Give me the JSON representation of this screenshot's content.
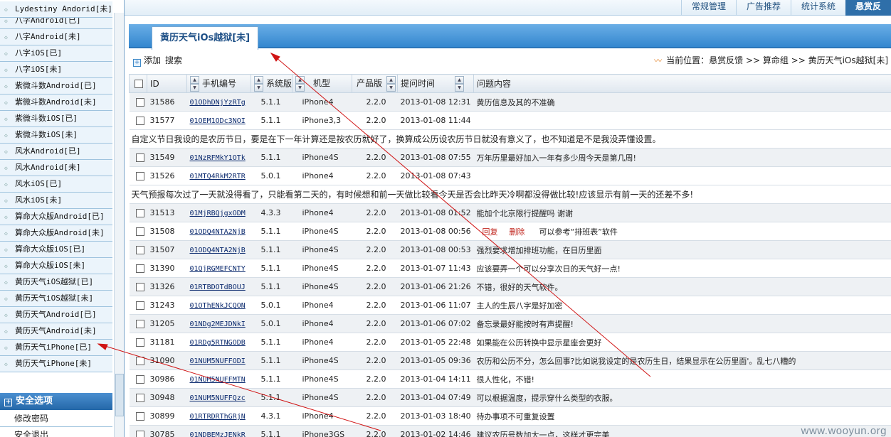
{
  "top_nav": [
    "常规管理",
    "广告推荐",
    "统计系统",
    "悬赏反"
  ],
  "sidebar": {
    "items": [
      "Lydestiny Andorid[未]",
      "八字Android[已]",
      "八字Android[未]",
      "八字iOS[已]",
      "八字iOS[未]",
      "紫微斗数Android[已]",
      "紫微斗数Android[未]",
      "紫微斗数iOS[已]",
      "紫微斗数iOS[未]",
      "风水Android[已]",
      "风水Android[未]",
      "风水iOS[已]",
      "风水iOS[未]",
      "算命大众版Android[已]",
      "算命大众版Android[未]",
      "算命大众版iOS[已]",
      "算命大众版iOS[未]",
      "黄历天气iOS越狱[已]",
      "黄历天气iOS越狱[未]",
      "黄历天气Android[已]",
      "黄历天气Android[未]",
      "黄历天气iPhone[已]",
      "黄历天气iPhone[未]"
    ],
    "section_title": "安全选项",
    "section_items": [
      "修改密码",
      "安全退出"
    ]
  },
  "tab_title": "黄历天气iOs越狱[未]",
  "toolbar": {
    "add": "添加",
    "search": "搜索"
  },
  "location": "当前位置：悬赏反馈 >> 算命组 >> 黄历天气iOs越狱[未]",
  "columns": [
    "ID",
    "手机编号",
    "系统版",
    "机型",
    "产品版",
    "提问时间",
    "问题内容"
  ],
  "actions": {
    "reply": "回复",
    "delete": "删除"
  },
  "rows": [
    {
      "id": "31586",
      "phone": "01ODhDNjYzRTg",
      "os": "5.1.1",
      "model": "iPhone4",
      "ver": "2.2.0",
      "time": "2013-01-08 12:31",
      "content": "黄历信息及其的不准确"
    },
    {
      "id": "31577",
      "phone": "01OEM1ODc3NOI",
      "os": "5.1.1",
      "model": "iPhone3,3",
      "ver": "2.2.0",
      "time": "2013-01-08 11:44",
      "content": "",
      "note": "自定义节日我设的是农历节日，要是在下一年计算还是按农历就好了，换算成公历设农历节日就没有意义了，也不知道是不是我没弄懂设置。"
    },
    {
      "id": "31549",
      "phone": "01NzRFMkY1OTk",
      "os": "5.1.1",
      "model": "iPhone4S",
      "ver": "2.2.0",
      "time": "2013-01-08 07:55",
      "content": "万年历里最好加入一年有多少周今天是第几周!"
    },
    {
      "id": "31526",
      "phone": "01MTQ4RkM2RTR",
      "os": "5.0.1",
      "model": "iPhone4",
      "ver": "2.2.0",
      "time": "2013-01-08 07:43",
      "content": "",
      "note": "天气预报每次过了一天就没得看了，只能看第二天的，有时候想和前一天做比较看今天是否会比昨天冷啊都没得做比较!应该显示有前一天的还差不多!"
    },
    {
      "id": "31513",
      "phone": "01MjRBQjgxODM",
      "os": "4.3.3",
      "model": "iPhone4",
      "ver": "2.2.0",
      "time": "2013-01-08 01:52",
      "content": "能加个北京限行提醒吗 谢谢"
    },
    {
      "id": "31508",
      "phone": "01ODQ4NTA2NjB",
      "os": "5.1.1",
      "model": "iPhone4S",
      "ver": "2.2.0",
      "time": "2013-01-08 00:56",
      "content": "可以参考“排班表”软件",
      "has_actions": true
    },
    {
      "id": "31507",
      "phone": "01ODQ4NTA2NjB",
      "os": "5.1.1",
      "model": "iPhone4S",
      "ver": "2.2.0",
      "time": "2013-01-08 00:53",
      "content": "强烈要求增加排班功能，在日历里面"
    },
    {
      "id": "31390",
      "phone": "01QjRGMEFCNTY",
      "os": "5.1.1",
      "model": "iPhone4S",
      "ver": "2.2.0",
      "time": "2013-01-07 11:43",
      "content": "应该要弄一个可以分享次日的天气好一点!"
    },
    {
      "id": "31326",
      "phone": "01RTBDOTdBOUJ",
      "os": "5.1.1",
      "model": "iPhone4S",
      "ver": "2.2.0",
      "time": "2013-01-06 21:26",
      "content": "不错，很好的天气软件。"
    },
    {
      "id": "31243",
      "phone": "01OThENkJCQON",
      "os": "5.0.1",
      "model": "iPhone4",
      "ver": "2.2.0",
      "time": "2013-01-06 11:07",
      "content": "主人的生辰八字是好加密"
    },
    {
      "id": "31205",
      "phone": "01NDg2MEJDNkI",
      "os": "5.0.1",
      "model": "iPhone4",
      "ver": "2.2.0",
      "time": "2013-01-06 07:02",
      "content": "备忘录最好能按时有声提醒!"
    },
    {
      "id": "31181",
      "phone": "01RDg5RTNGODB",
      "os": "5.1.1",
      "model": "iPhone4",
      "ver": "2.2.0",
      "time": "2013-01-05 22:48",
      "content": "如果能在公历转换中显示星座会更好"
    },
    {
      "id": "31090",
      "phone": "01NUM5NUFFODI",
      "os": "5.1.1",
      "model": "iPhone4S",
      "ver": "2.2.0",
      "time": "2013-01-05 09:36",
      "content": "农历和公历不分，怎么回事?比如说我设定的是农历生日，结果显示在公历里面'。乱七八糟的"
    },
    {
      "id": "30986",
      "phone": "01NUM5NUFFMTN",
      "os": "5.1.1",
      "model": "iPhone4S",
      "ver": "2.2.0",
      "time": "2013-01-04 14:11",
      "content": "很人性化，不错!"
    },
    {
      "id": "30948",
      "phone": "01NUM5NUFFQzc",
      "os": "5.1.1",
      "model": "iPhone4S",
      "ver": "2.2.0",
      "time": "2013-01-04 07:49",
      "content": "可以根据温度，提示穿什么类型的衣服。"
    },
    {
      "id": "30899",
      "phone": "01RTRDRThGRjN",
      "os": "4.3.1",
      "model": "iPhone4",
      "ver": "2.2.0",
      "time": "2013-01-03 18:40",
      "content": "待办事项不可重复设置"
    },
    {
      "id": "30785",
      "phone": "01NDBEMzJENkR",
      "os": "5.1.1",
      "model": "iPhone3GS",
      "ver": "2.2.0",
      "time": "2013-01-02 14:46",
      "content": "建议农历号数加大一点，这样才更完美"
    }
  ],
  "watermark": "www.wooyun.org"
}
